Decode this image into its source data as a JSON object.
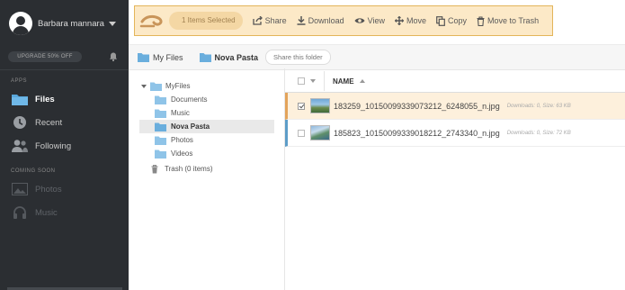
{
  "user": {
    "name": "Barbara mannara"
  },
  "sidebar": {
    "upgrade_label": "UPGRADE 50% OFF",
    "apps_heading": "APPS",
    "items": [
      {
        "label": "Files"
      },
      {
        "label": "Recent"
      },
      {
        "label": "Following"
      }
    ],
    "coming_soon_heading": "COMING SOON",
    "coming_soon": [
      {
        "label": "Photos"
      },
      {
        "label": "Music"
      }
    ]
  },
  "toolbar": {
    "selected_label": "1 Items Selected",
    "share": "Share",
    "download": "Download",
    "view": "View",
    "move": "Move",
    "copy": "Copy",
    "trash": "Move to Trash"
  },
  "breadcrumb": {
    "root": "My Files",
    "current": "Nova Pasta",
    "share_button": "Share this folder"
  },
  "tree": {
    "root": "MyFiles",
    "folders": [
      "Documents",
      "Music",
      "Nova Pasta",
      "Photos",
      "Videos"
    ],
    "trash": "Trash (0 items)"
  },
  "files": {
    "name_header": "NAME",
    "rows": [
      {
        "name": "183259_10150099339073212_6248055_n.jpg",
        "meta": "Downloads: 0, Size: 63 KB"
      },
      {
        "name": "185823_10150099339018212_2743340_n.jpg",
        "meta": "Downloads: 0, Size: 72 KB"
      }
    ]
  },
  "colors": {
    "sidebar_bg": "#2b2e32",
    "toolbar_bg": "#fce9c7",
    "toolbar_border": "#e3b55a",
    "accent_blue": "#5aa8dc"
  }
}
